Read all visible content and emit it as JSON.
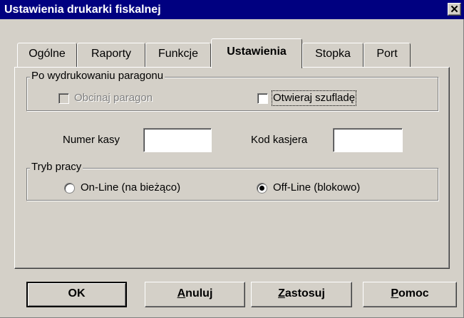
{
  "window": {
    "title": "Ustawienia drukarki fiskalnej",
    "close_glyph": "✕"
  },
  "tabs": [
    {
      "label": "Ogólne"
    },
    {
      "label": "Raporty"
    },
    {
      "label": "Funkcje"
    },
    {
      "label": "Ustawienia",
      "active": true
    },
    {
      "label": "Stopka"
    },
    {
      "label": "Port"
    }
  ],
  "after_print": {
    "legend": "Po wydrukowaniu paragonu",
    "cut_receipt": {
      "label": "Obcinaj paragon",
      "checked": false,
      "disabled": true
    },
    "open_drawer": {
      "label": "Otwieraj szufladę",
      "checked": false
    }
  },
  "register_number": {
    "label": "Numer kasy",
    "value": ""
  },
  "cashier_code": {
    "label": "Kod kasjera",
    "value": ""
  },
  "work_mode": {
    "legend": "Tryb pracy",
    "online": {
      "label": "On-Line (na bieżąco)",
      "selected": false
    },
    "offline": {
      "label": "Off-Line (blokowo)",
      "selected": true
    }
  },
  "buttons": {
    "ok": "OK",
    "cancel_mnemonic": "A",
    "cancel_rest": "nuluj",
    "apply_mnemonic": "Z",
    "apply_rest": "astosuj",
    "help_mnemonic": "P",
    "help_rest": "omoc"
  }
}
